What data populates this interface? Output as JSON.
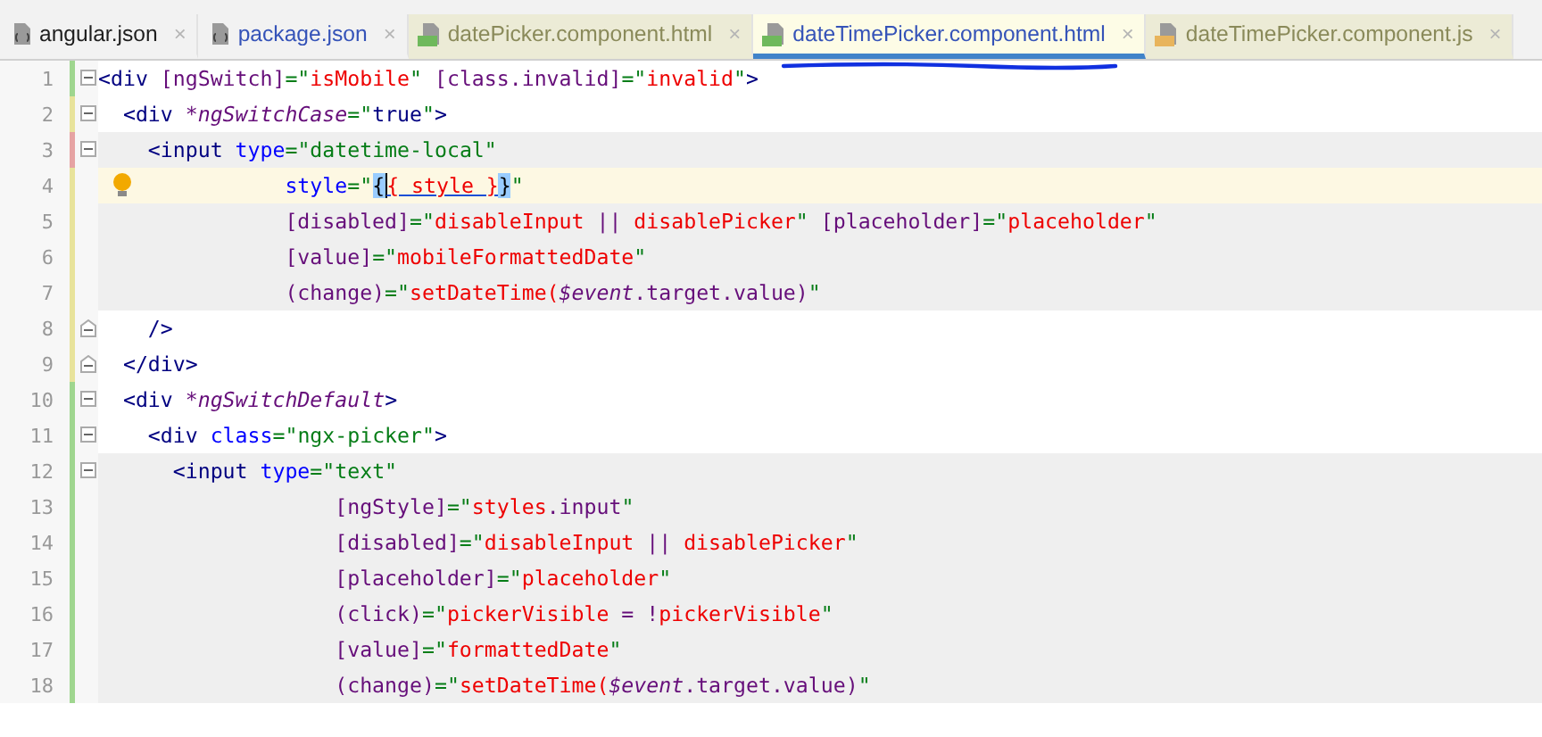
{
  "tabs": [
    {
      "label": "angular.json",
      "kind": "json",
      "selected": false,
      "tinted": false,
      "color": "#1e1e1e",
      "close": "×"
    },
    {
      "label": "package.json",
      "kind": "json",
      "selected": false,
      "tinted": false,
      "color": "#3553b8",
      "close": "×"
    },
    {
      "label": "datePicker.component.html",
      "kind": "html",
      "selected": false,
      "tinted": true,
      "color": "#8a8a5a",
      "close": "×"
    },
    {
      "label": "dateTimePicker.component.html",
      "kind": "html",
      "selected": true,
      "tinted": true,
      "color": "#3553b8",
      "close": "×"
    },
    {
      "label": "dateTimePicker.component.js",
      "kind": "js",
      "selected": false,
      "tinted": true,
      "color": "#8a8a5a",
      "close": "×"
    }
  ],
  "scribble": true,
  "lines": [
    {
      "number": "1",
      "color": "#9fd68f",
      "fold_start": true,
      "fold_end": false,
      "shaded": false,
      "current": false,
      "bulb": false,
      "tokens": [
        {
          "kind": "tag",
          "text": "<div"
        },
        {
          "kind": "binding",
          "text": " [ngSwitch]"
        },
        {
          "kind": "str",
          "text": "=\""
        },
        {
          "kind": "expr",
          "text": "isMobile"
        },
        {
          "kind": "str",
          "text": "\""
        },
        {
          "kind": "binding",
          "text": " [class.invalid]"
        },
        {
          "kind": "str",
          "text": "=\""
        },
        {
          "kind": "expr",
          "text": "invalid"
        },
        {
          "kind": "str",
          "text": "\""
        },
        {
          "kind": "tag",
          "text": ">"
        }
      ]
    },
    {
      "number": "2",
      "color": "#e8e39b",
      "fold_start": true,
      "fold_end": false,
      "shaded": false,
      "current": false,
      "bulb": false,
      "tokens": [
        {
          "kind": "tag",
          "text": "  <div"
        },
        {
          "kind": "directive",
          "text": " *ngSwitchCase"
        },
        {
          "kind": "str",
          "text": "=\""
        },
        {
          "kind": "tag",
          "text": "true"
        },
        {
          "kind": "str",
          "text": "\""
        },
        {
          "kind": "tag",
          "text": ">"
        }
      ]
    },
    {
      "number": "3",
      "color": "#e6a3a3",
      "fold_start": true,
      "fold_end": false,
      "shaded": true,
      "current": false,
      "bulb": false,
      "tokens": [
        {
          "kind": "tag",
          "text": "    <input"
        },
        {
          "kind": "attr",
          "text": " type"
        },
        {
          "kind": "str",
          "text": "=\"datetime-local\""
        }
      ]
    },
    {
      "number": "4",
      "color": "#e8e39b",
      "fold_start": false,
      "fold_end": false,
      "shaded": false,
      "current": true,
      "bulb": true,
      "tokens": [
        {
          "kind": "attr",
          "text": "               style"
        },
        {
          "kind": "str",
          "text": "=\""
        },
        {
          "kind": "match",
          "text": "{"
        },
        {
          "kind": "expr",
          "text": "{ style }",
          "caret": true,
          "underline": true
        },
        {
          "kind": "match",
          "text": "}"
        },
        {
          "kind": "str",
          "text": "\""
        }
      ]
    },
    {
      "number": "5",
      "color": "#e8e39b",
      "fold_start": false,
      "fold_end": false,
      "shaded": true,
      "current": false,
      "bulb": false,
      "tokens": [
        {
          "kind": "binding",
          "text": "               [disabled]"
        },
        {
          "kind": "str",
          "text": "=\""
        },
        {
          "kind": "expr",
          "text": "disableInput"
        },
        {
          "kind": "binding",
          "text": " || "
        },
        {
          "kind": "expr",
          "text": "disablePicker"
        },
        {
          "kind": "str",
          "text": "\""
        },
        {
          "kind": "binding",
          "text": " [placeholder]"
        },
        {
          "kind": "str",
          "text": "=\""
        },
        {
          "kind": "expr",
          "text": "placeholder"
        },
        {
          "kind": "str",
          "text": "\""
        }
      ]
    },
    {
      "number": "6",
      "color": "#e8e39b",
      "fold_start": false,
      "fold_end": false,
      "shaded": true,
      "current": false,
      "bulb": false,
      "tokens": [
        {
          "kind": "binding",
          "text": "               [value]"
        },
        {
          "kind": "str",
          "text": "=\""
        },
        {
          "kind": "expr",
          "text": "mobileFormattedDate"
        },
        {
          "kind": "str",
          "text": "\""
        }
      ]
    },
    {
      "number": "7",
      "color": "#e8e39b",
      "fold_start": false,
      "fold_end": false,
      "shaded": true,
      "current": false,
      "bulb": false,
      "tokens": [
        {
          "kind": "binding",
          "text": "               (change)"
        },
        {
          "kind": "str",
          "text": "=\""
        },
        {
          "kind": "expr",
          "text": "setDateTime("
        },
        {
          "kind": "evar",
          "text": "$event"
        },
        {
          "kind": "binding",
          "text": ".target.value)"
        },
        {
          "kind": "str",
          "text": "\""
        }
      ]
    },
    {
      "number": "8",
      "color": "#e8e39b",
      "fold_start": false,
      "fold_end": true,
      "shaded": false,
      "current": false,
      "bulb": false,
      "tokens": [
        {
          "kind": "tag",
          "text": "    />"
        }
      ]
    },
    {
      "number": "9",
      "color": "#e8e39b",
      "fold_start": false,
      "fold_end": true,
      "shaded": false,
      "current": false,
      "bulb": false,
      "tokens": [
        {
          "kind": "tag",
          "text": "  </div>"
        }
      ]
    },
    {
      "number": "10",
      "color": "#9fd68f",
      "fold_start": true,
      "fold_end": false,
      "shaded": false,
      "current": false,
      "bulb": false,
      "tokens": [
        {
          "kind": "tag",
          "text": "  <div"
        },
        {
          "kind": "directive",
          "text": " *ngSwitchDefault"
        },
        {
          "kind": "tag",
          "text": ">"
        }
      ]
    },
    {
      "number": "11",
      "color": "#9fd68f",
      "fold_start": true,
      "fold_end": false,
      "shaded": false,
      "current": false,
      "bulb": false,
      "tokens": [
        {
          "kind": "tag",
          "text": "    <div"
        },
        {
          "kind": "attr",
          "text": " class"
        },
        {
          "kind": "str",
          "text": "=\"ngx-picker\""
        },
        {
          "kind": "tag",
          "text": ">"
        }
      ]
    },
    {
      "number": "12",
      "color": "#9fd68f",
      "fold_start": true,
      "fold_end": false,
      "shaded": true,
      "current": false,
      "bulb": false,
      "tokens": [
        {
          "kind": "tag",
          "text": "      <input"
        },
        {
          "kind": "attr",
          "text": " type"
        },
        {
          "kind": "str",
          "text": "=\"text\""
        }
      ]
    },
    {
      "number": "13",
      "color": "#9fd68f",
      "fold_start": false,
      "fold_end": false,
      "shaded": true,
      "current": false,
      "bulb": false,
      "tokens": [
        {
          "kind": "binding",
          "text": "                   [ngStyle]"
        },
        {
          "kind": "str",
          "text": "=\""
        },
        {
          "kind": "expr",
          "text": "styles"
        },
        {
          "kind": "binding",
          "text": ".input"
        },
        {
          "kind": "str",
          "text": "\""
        }
      ]
    },
    {
      "number": "14",
      "color": "#9fd68f",
      "fold_start": false,
      "fold_end": false,
      "shaded": true,
      "current": false,
      "bulb": false,
      "tokens": [
        {
          "kind": "binding",
          "text": "                   [disabled]"
        },
        {
          "kind": "str",
          "text": "=\""
        },
        {
          "kind": "expr",
          "text": "disableInput"
        },
        {
          "kind": "binding",
          "text": " || "
        },
        {
          "kind": "expr",
          "text": "disablePicker"
        },
        {
          "kind": "str",
          "text": "\""
        }
      ]
    },
    {
      "number": "15",
      "color": "#9fd68f",
      "fold_start": false,
      "fold_end": false,
      "shaded": true,
      "current": false,
      "bulb": false,
      "tokens": [
        {
          "kind": "binding",
          "text": "                   [placeholder]"
        },
        {
          "kind": "str",
          "text": "=\""
        },
        {
          "kind": "expr",
          "text": "placeholder"
        },
        {
          "kind": "str",
          "text": "\""
        }
      ]
    },
    {
      "number": "16",
      "color": "#9fd68f",
      "fold_start": false,
      "fold_end": false,
      "shaded": true,
      "current": false,
      "bulb": false,
      "tokens": [
        {
          "kind": "binding",
          "text": "                   (click)"
        },
        {
          "kind": "str",
          "text": "=\""
        },
        {
          "kind": "expr",
          "text": "pickerVisible"
        },
        {
          "kind": "binding",
          "text": " = !"
        },
        {
          "kind": "expr",
          "text": "pickerVisible"
        },
        {
          "kind": "str",
          "text": "\""
        }
      ]
    },
    {
      "number": "17",
      "color": "#9fd68f",
      "fold_start": false,
      "fold_end": false,
      "shaded": true,
      "current": false,
      "bulb": false,
      "tokens": [
        {
          "kind": "binding",
          "text": "                   [value]"
        },
        {
          "kind": "str",
          "text": "=\""
        },
        {
          "kind": "expr",
          "text": "formattedDate"
        },
        {
          "kind": "str",
          "text": "\""
        }
      ]
    },
    {
      "number": "18",
      "color": "#9fd68f",
      "fold_start": false,
      "fold_end": false,
      "shaded": true,
      "current": false,
      "bulb": false,
      "tokens": [
        {
          "kind": "binding",
          "text": "                   (change)"
        },
        {
          "kind": "str",
          "text": "=\""
        },
        {
          "kind": "expr",
          "text": "setDateTime("
        },
        {
          "kind": "evar",
          "text": "$event"
        },
        {
          "kind": "binding",
          "text": ".target.value)"
        },
        {
          "kind": "str",
          "text": "\""
        }
      ]
    }
  ]
}
